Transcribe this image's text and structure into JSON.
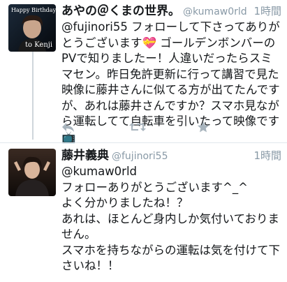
{
  "tweets": [
    {
      "display_name": "あやの＠くまの世界。",
      "handle": "@kumaw0rld",
      "timestamp": "1時間",
      "avatar_caption_top": "Happy Birthday",
      "avatar_caption_bottom": "to Kenji",
      "text": "@fujinori55 フォローして下さってありがとうございます💝 ゴールデンボンバーのPVで知りましたー！人違いだったらスミマセン。昨日免許更新に行って講習で見た映像に藤井さんに似てる方が出てたんですが、あれは藤井さんですか？スマホ見ながら運転してて自転車を引いたって映像です📺",
      "actions": [
        "reply-icon",
        "retweet-icon",
        "favorite-icon"
      ]
    },
    {
      "display_name": "藤井義典",
      "handle": "@fujinori55",
      "timestamp": "1時間",
      "text": "@kumaw0rld\nフォローありがとうございます^_^\nよく分かりましたね！？\nあれは、ほとんど身内しか気付いておりません。\nスマホを持ちながらの運転は気を付けて下さいね！！",
      "actions": []
    }
  ]
}
